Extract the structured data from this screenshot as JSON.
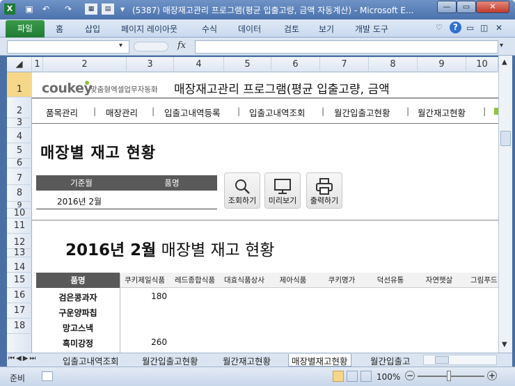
{
  "window": {
    "title": "(5387) 매장재고관리 프로그램(평균 입출고량, 금액 자동계산) - Microsoft E...",
    "minimize": "—",
    "maximize": "▭",
    "close": "✕"
  },
  "ribbon": {
    "file_tab": "파일",
    "tabs": [
      "홈",
      "삽입",
      "페이지 레이아웃",
      "수식",
      "데이터",
      "검토",
      "보기",
      "개발 도구"
    ]
  },
  "formula_bar": {
    "fx": "fx",
    "name_box": "",
    "formula": ""
  },
  "columns": [
    "1",
    "2",
    "3",
    "4",
    "5",
    "6",
    "7",
    "8",
    "9",
    "10"
  ],
  "rows": [
    "1",
    "2",
    "3",
    "4",
    "5",
    "6",
    "7",
    "8",
    "9",
    "10",
    "11",
    "12",
    "13",
    "14",
    "15",
    "16",
    "17",
    "18"
  ],
  "sheet": {
    "logo": "coukey",
    "logo_sub": "맞춤형엑셀업무자동화",
    "program_title": "매장재고관리 프로그램(평균 입출고량, 금액",
    "nav": [
      "품목관리",
      "매장관리",
      "입출고내역등록",
      "입출고내역조회",
      "월간입출고현황",
      "월간재고현황"
    ],
    "nav_sep": "|",
    "page_title": "매장별 재고 현황",
    "filter": {
      "header_month": "기준월",
      "header_item": "품명",
      "month_value": "2016년 2월",
      "item_value": ""
    },
    "buttons": {
      "search": "조회하기",
      "preview": "미리보기",
      "print": "출력하기"
    },
    "report_title_bold": "2016년 2월",
    "report_title_rest": " 매장별 재고 현황",
    "table": {
      "header_item": "품명",
      "stores": [
        "쿠키제일식품",
        "레드종합식품",
        "대효식품상사",
        "제아식품",
        "쿠키명가",
        "덕선유통",
        "자연햇살",
        "그림푸드"
      ],
      "rows": [
        {
          "name": "검은콩과자",
          "v1": "180"
        },
        {
          "name": "구운양파칩",
          "v1": ""
        },
        {
          "name": "망고스낵",
          "v1": ""
        },
        {
          "name": "흑미강정",
          "v1": "260"
        }
      ]
    }
  },
  "sheet_tabs": {
    "tabs": [
      "입출고내역조회",
      "월간입출고현황",
      "월간재고현황",
      "매장별재고현황",
      "월간입출고"
    ],
    "active": "매장별재고현황"
  },
  "status": {
    "ready": "준비",
    "zoom": "100%"
  }
}
